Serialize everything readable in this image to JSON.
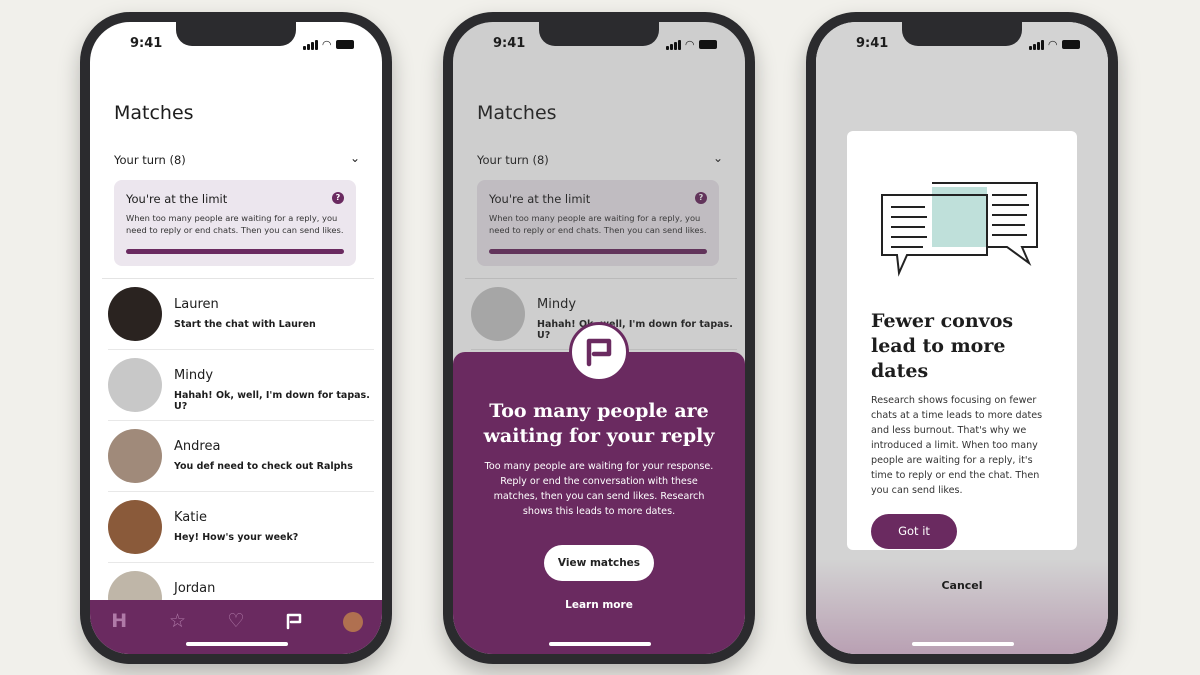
{
  "status": {
    "time": "9:41"
  },
  "matches": {
    "title": "Matches",
    "your_turn": "Your turn (8)",
    "limit": {
      "title": "You're at the limit",
      "body": "When too many people are waiting for a reply, you need to reply or end chats. Then you can send likes.",
      "progress": 1.0
    },
    "items": [
      {
        "name": "Lauren",
        "message": "Start the chat with Lauren",
        "color": "#2a2320"
      },
      {
        "name": "Mindy",
        "message": "Hahah! Ok, well, I'm down for tapas. U?",
        "color": "#c8c8c8"
      },
      {
        "name": "Andrea",
        "message": "You def need to check out Ralphs",
        "color": "#a08a7a"
      },
      {
        "name": "Katie",
        "message": "Hey! How's your week?",
        "color": "#8a5a3a"
      },
      {
        "name": "Jordan",
        "message": "",
        "color": "#bfb6a8"
      }
    ]
  },
  "tabbar": [
    "hinge-logo-icon",
    "star-icon",
    "heart-icon",
    "chat-icon",
    "profile-avatar"
  ],
  "modal": {
    "title": "Too many people are waiting for your reply",
    "body": "Too many people are waiting for your response. Reply or end the conversation with these matches, then you can send likes. Research shows this leads to more dates.",
    "primary": "View matches",
    "secondary": "Learn more"
  },
  "info": {
    "title": "Fewer convos lead to more dates",
    "body": "Research shows focusing on fewer chats at a time leads to more dates and less burnout. That's why we introduced a limit. When too many people are waiting for a reply, it's time to reply or end the chat. Then you can send likes.",
    "button": "Got it",
    "cancel": "Cancel"
  },
  "colors": {
    "brand": "#6a2a60",
    "background": "#f1f0eb"
  }
}
